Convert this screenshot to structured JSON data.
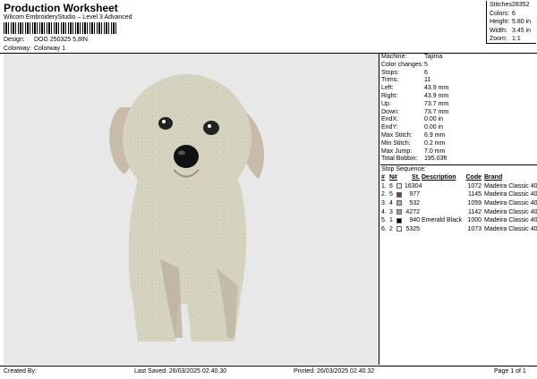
{
  "header": {
    "title": "Production Worksheet",
    "subtitle": "Wilcom EmbroideryStudio – Level 3 Advanced",
    "design_label": "Design:",
    "design_value": "DOG 250325 5,8IN",
    "colorway_label": "Colorway:",
    "colorway_value": "Colorway 1"
  },
  "stats": [
    {
      "label": "Stitches:",
      "value": "28352"
    },
    {
      "label": "Colors:",
      "value": "6"
    },
    {
      "label": "Height:",
      "value": "5.80 in"
    },
    {
      "label": "Width:",
      "value": "3.45 in"
    },
    {
      "label": "Zoom:",
      "value": "1:1"
    }
  ],
  "info": [
    {
      "label": "Machine:",
      "value": "Tajima"
    },
    {
      "label": "Color changes:",
      "value": "5"
    },
    {
      "label": "Stops:",
      "value": "6"
    },
    {
      "label": "Trims:",
      "value": "11"
    },
    {
      "label": "Left:",
      "value": "43.9 mm"
    },
    {
      "label": "Right:",
      "value": "43.9 mm"
    },
    {
      "label": "Up:",
      "value": "73.7 mm"
    },
    {
      "label": "Down:",
      "value": "73.7 mm"
    },
    {
      "label": "EndX:",
      "value": "0.00 in"
    },
    {
      "label": "EndY:",
      "value": "0.00 in"
    },
    {
      "label": "Max Stitch:",
      "value": "6.9 mm"
    },
    {
      "label": "Min Stitch:",
      "value": "0.2 mm"
    },
    {
      "label": "Max Jump:",
      "value": "7.0 mm"
    },
    {
      "label": "Total Bobbin:",
      "value": "195.03ft"
    }
  ],
  "stop_sequence": {
    "title": "Stop Sequence:",
    "headers": {
      "num": "#",
      "n": "N#",
      "st": "St.",
      "desc": "Description",
      "code": "Code",
      "brand": "Brand"
    },
    "rows": [
      {
        "num": "1.",
        "n": "6",
        "color": "#e9e6de",
        "st": "16304",
        "desc": "",
        "code": "1072",
        "brand": "Madeira Classic 40"
      },
      {
        "num": "2.",
        "n": "5",
        "color": "#6b4a3c",
        "st": "977",
        "desc": "",
        "code": "1145",
        "brand": "Madeira Classic 40"
      },
      {
        "num": "3.",
        "n": "4",
        "color": "#b9a79c",
        "st": "532",
        "desc": "",
        "code": "1059",
        "brand": "Madeira Classic 40"
      },
      {
        "num": "4.",
        "n": "3",
        "color": "#a89a94",
        "st": "4272",
        "desc": "",
        "code": "1142",
        "brand": "Madeira Classic 40"
      },
      {
        "num": "5.",
        "n": "1",
        "color": "#000000",
        "st": "940",
        "desc": "Emerald Black",
        "code": "1000",
        "brand": "Madeira Classic 40"
      },
      {
        "num": "6.",
        "n": "2",
        "color": "#f2f2f2",
        "st": "5325",
        "desc": "",
        "code": "1073",
        "brand": "Madeira Classic 40"
      }
    ]
  },
  "footer": {
    "created": "Created By:",
    "last_saved": "Last Saved: 26/03/2025 02.40.30",
    "printed": "Printed: 26/03/2025 02.40.32",
    "page": "Page 1 of 1"
  },
  "colors": {
    "canvas": "#e8e8e8",
    "dog_body": "#d9d8c4",
    "dog_shadow": "#b9ab9c"
  }
}
